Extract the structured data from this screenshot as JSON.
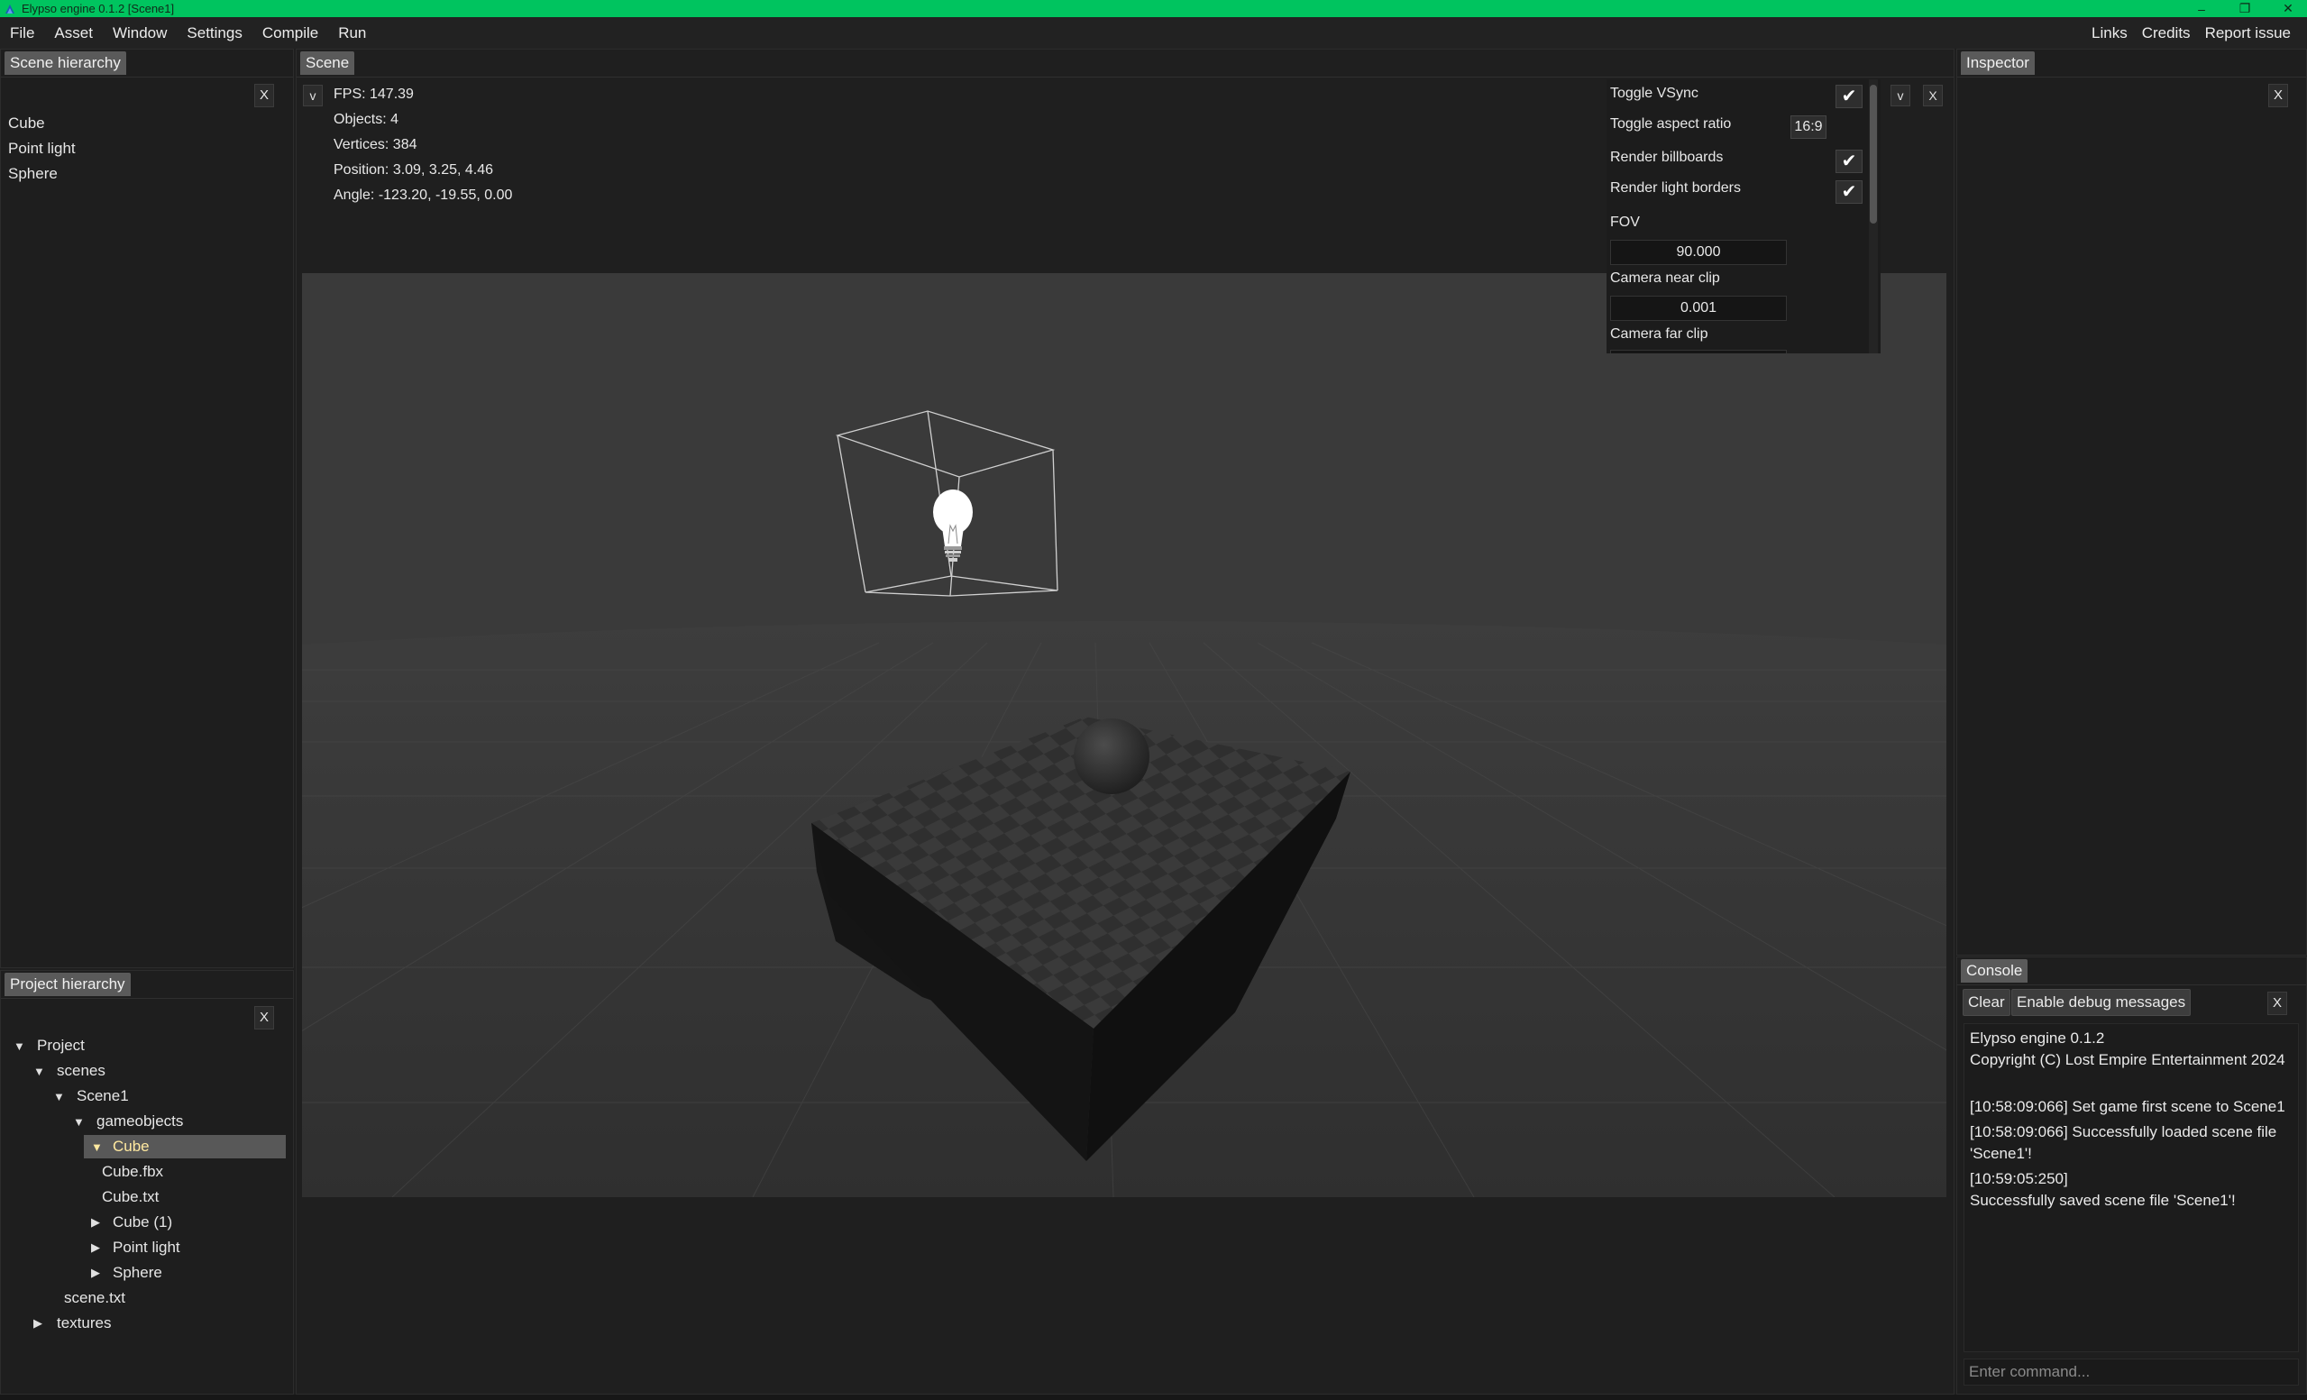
{
  "window": {
    "title": "Elypso engine 0.1.2 [Scene1]",
    "controls": {
      "minimize": "–",
      "restore": "❐",
      "close": "✕"
    }
  },
  "menu": {
    "left": [
      "File",
      "Asset",
      "Window",
      "Settings",
      "Compile",
      "Run"
    ],
    "right": [
      "Links",
      "Credits",
      "Report issue"
    ]
  },
  "scene_hierarchy": {
    "title": "Scene hierarchy",
    "close": "X",
    "items": [
      "Cube",
      "Point light",
      "Sphere"
    ]
  },
  "project_hierarchy": {
    "title": "Project hierarchy",
    "close": "X",
    "tree": [
      {
        "label": "Project",
        "arrow": "▼"
      },
      {
        "label": "scenes",
        "arrow": "▼"
      },
      {
        "label": "Scene1",
        "arrow": "▼"
      },
      {
        "label": "gameobjects",
        "arrow": "▼"
      },
      {
        "label": "Cube",
        "arrow": "▼",
        "selected": true
      },
      {
        "label": "Cube.fbx",
        "arrow": ""
      },
      {
        "label": "Cube.txt",
        "arrow": ""
      },
      {
        "label": "Cube (1)",
        "arrow": "▶"
      },
      {
        "label": "Point light",
        "arrow": "▶"
      },
      {
        "label": "Sphere",
        "arrow": "▶"
      },
      {
        "label": "scene.txt",
        "arrow": ""
      },
      {
        "label": "textures",
        "arrow": "▶"
      }
    ]
  },
  "scene": {
    "title": "Scene",
    "collapse": "v",
    "stats": {
      "fps": "FPS: 147.39",
      "objects": "Objects: 4",
      "vertices": "Vertices: 384",
      "position": "Position: 3.09, 3.25, 4.46",
      "angle": "Angle: -123.20, -19.55, 0.00"
    },
    "settings": {
      "collapse": "v",
      "close": "X",
      "toggle_vsync": "Toggle VSync",
      "toggle_aspect_ratio": "Toggle aspect ratio",
      "aspect_value": "16:9",
      "render_billboards": "Render billboards",
      "render_light_borders": "Render light borders",
      "check": "✔",
      "fov_label": "FOV",
      "fov_value": "90.000",
      "near_clip_label": "Camera near clip",
      "near_clip_value": "0.001",
      "far_clip_label": "Camera far clip"
    }
  },
  "inspector": {
    "title": "Inspector",
    "close": "X"
  },
  "console": {
    "title": "Console",
    "clear": "Clear",
    "debug": "Enable debug messages",
    "close": "X",
    "lines": [
      "Elypso engine 0.1.2",
      "Copyright (C) Lost Empire Entertainment 2024",
      "[10:58:09:066] Set game first scene to Scene1",
      "[10:58:09:066] Successfully loaded scene file",
      "'Scene1'!",
      "[10:59:05:250]",
      "Successfully saved scene file 'Scene1'!"
    ],
    "input_placeholder": "Enter command..."
  }
}
